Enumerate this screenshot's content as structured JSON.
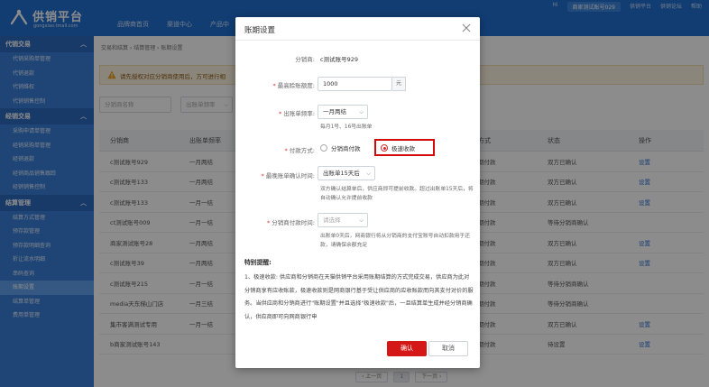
{
  "header": {
    "logo_title": "供销平台",
    "logo_sub": "gongxiao.tmall.com",
    "nav": [
      "品牌商首页",
      "渠道中心",
      "产品中"
    ],
    "top_right": [
      "Hi",
      "商家测试账号029",
      "供销平台",
      "供销论坛",
      "帮助"
    ]
  },
  "sidebar": {
    "groups": [
      {
        "title": "代销交易",
        "items": [
          "代销采购单管理",
          "代销退款",
          "代销维权",
          "代销销售控制"
        ]
      },
      {
        "title": "经销交易",
        "items": [
          "采购申请单管理",
          "经销采购单管理",
          "经销退款",
          "经销商品销售跟踪",
          "经销销售控制"
        ]
      },
      {
        "title": "结算管理",
        "items": [
          "结算方式管理",
          "预存款管理",
          "预存款明细查询",
          "折让流水明细",
          "串码查询",
          "账期设置",
          "结算单管理",
          "费用单管理"
        ]
      }
    ],
    "active_item": "账期设置"
  },
  "main": {
    "breadcrumb": "交易和结算  ›  结算管理  ›  账期设置",
    "warning": "请先授权对应分销商使用后，方可进行相",
    "filter_name_placeholder": "分销商名称",
    "filter_freq_placeholder": "出账单频率",
    "table": {
      "headers": [
        "分销商",
        "出账单频率",
        "方式",
        "状态",
        "操作"
      ],
      "rows": [
        [
          "c测试账号929",
          "一月两结",
          "期付款",
          "双方已确认",
          "设置"
        ],
        [
          "c测试账号133",
          "一月两结",
          "期付款",
          "双方已确认",
          "设置"
        ],
        [
          "c测试账号133",
          "一月一结",
          "期付款",
          "双方已确认",
          "设置"
        ],
        [
          "ct测试账号009",
          "一月一结",
          "期付款",
          "等待分销商确认",
          ""
        ],
        [
          "商家测试账号28",
          "一月两结",
          "期付款",
          "双方已确认",
          "设置"
        ],
        [
          "c测试账号39",
          "一月两结",
          "期付款",
          "双方已确认",
          "设置"
        ],
        [
          "c测试账号215",
          "一月一结",
          "期付款",
          "等待分销商确认",
          ""
        ],
        [
          "media天东梯山门店",
          "一月三结",
          "期付款",
          "等待分销商确认",
          ""
        ],
        [
          "集市客满测试专用",
          "一月一结",
          "期付款",
          "双方已确认",
          "设置"
        ],
        [
          "b商家测试账号143",
          "",
          "期付款",
          "待设置",
          "设置"
        ]
      ]
    },
    "pagination": {
      "prev": "‹ 上一页",
      "current": "1",
      "next": "下一页 ›"
    }
  },
  "modal": {
    "title": "账期设置",
    "distributor_label": "分销商:",
    "distributor_value": "c测试账号929",
    "max_amount_label": "最高賒账额度:",
    "max_amount_value": "1000",
    "max_amount_unit": "元",
    "freq_label": "出账单频率:",
    "freq_value": "一月两结",
    "freq_hint": "每月1号、16号出账单",
    "pay_label": "付款方式:",
    "pay_option1": "分销商付款",
    "pay_option2": "极速收款",
    "pay_selected": "极速收款",
    "confirm_time_label": "最晚账单确认时间:",
    "confirm_time_value": "出账单15天后",
    "confirm_time_hint": "双方确认结算单后，供应商即可提前收款。超过出账单15天后，将自动确认允许提前收款",
    "dist_pay_label": "分销商付款时间:",
    "dist_pay_placeholder": "请选择",
    "dist_pay_hint": "出账单0天后，网商银行将从分销商的支付宝账号自动扣款用于还款，请确保余额充足",
    "notice_title": "特别提醒:",
    "notice_text": "1、极速收款: 供应商和分销商在天猫供销平台采用账期结算的方式完成交易，供应商为此对分销商享有应收账款，极速收款则是网商银行基于受让供应商的应收账款而向其支付对价的服务。当供应商和分销商进行\"账期设置\"并且选择\"极速收款\"后，一旦结算单生成并经分销商确认，供应商即可向网商银行申",
    "ok_label": "确认",
    "cancel_label": "取消"
  }
}
